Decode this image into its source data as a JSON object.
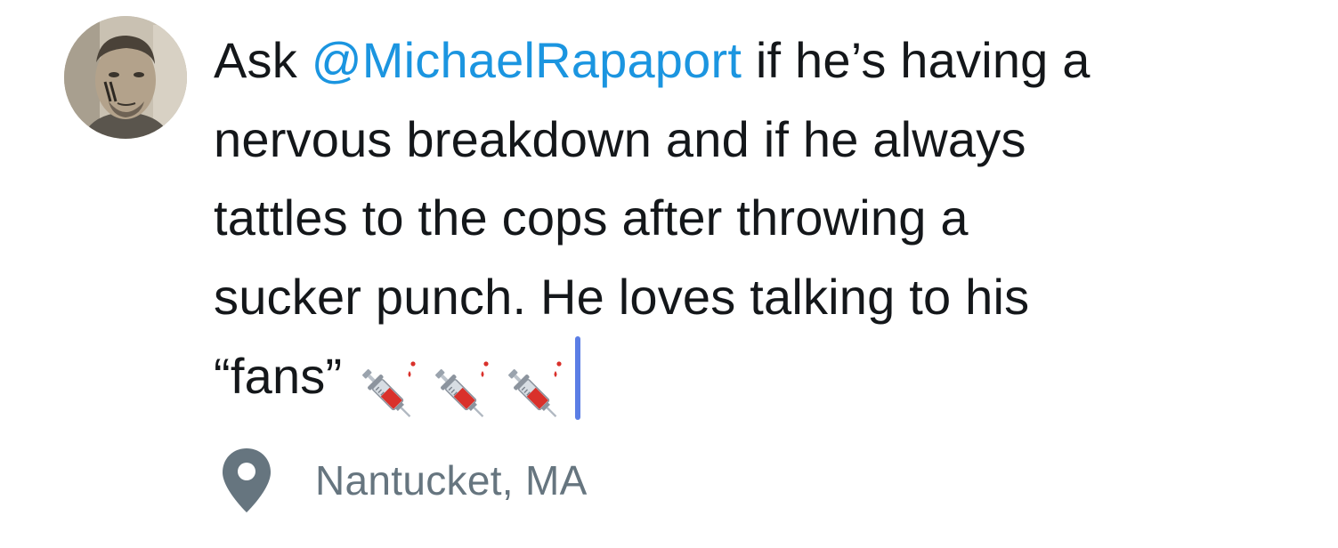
{
  "tweet": {
    "lines": [
      {
        "before": "Ask ",
        "mention": "@MichaelRapaport",
        "after": " if he’s having a"
      },
      {
        "text": "nervous breakdown and if he always"
      },
      {
        "text": "tattles to the cops after throwing a"
      },
      {
        "text": "sucker punch. He loves talking to his"
      },
      {
        "text": "“fans”"
      }
    ],
    "emoji": [
      "syringe-emoji",
      "syringe-emoji",
      "syringe-emoji"
    ]
  },
  "location": {
    "icon": "location-pin-icon",
    "label": "Nantucket, MA"
  },
  "colors": {
    "text": "#14171a",
    "mention": "#1b95e0",
    "caret": "#5b7ee5",
    "secondary": "#66757f"
  }
}
